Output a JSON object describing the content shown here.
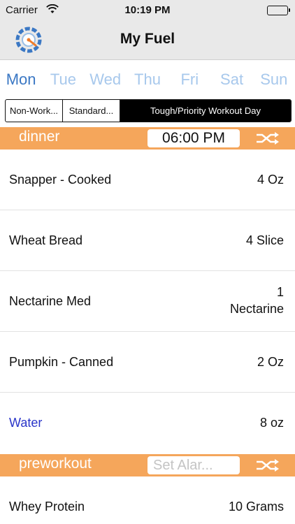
{
  "status_bar": {
    "carrier": "Carrier",
    "time": "10:19 PM"
  },
  "nav": {
    "title": "My Fuel",
    "logo_icon": "gauge-logo-icon"
  },
  "days": [
    {
      "label": "Mon",
      "active": true
    },
    {
      "label": "Tue",
      "active": false
    },
    {
      "label": "Wed",
      "active": false
    },
    {
      "label": "Thu",
      "active": false
    },
    {
      "label": "Fri",
      "active": false
    },
    {
      "label": "Sat",
      "active": false
    },
    {
      "label": "Sun",
      "active": false
    }
  ],
  "day_types": {
    "options": [
      "Non-Work...",
      "Standard...",
      "Tough/Priority Workout Day"
    ],
    "selected": "Tough/Priority Workout Day"
  },
  "meals": [
    {
      "name": "dinner",
      "time": "06:00 PM",
      "items": [
        {
          "food": "Snapper - Cooked",
          "qty": "4 Oz"
        },
        {
          "food": "Wheat Bread",
          "qty": "4 Slice"
        },
        {
          "food": "Nectarine Med",
          "qty_line1": "1",
          "qty_line2": "Nectarine"
        },
        {
          "food": "Pumpkin - Canned",
          "qty": "2 Oz"
        },
        {
          "food": "Water",
          "qty": "8 oz"
        }
      ]
    },
    {
      "name": "preworkout",
      "time_placeholder": "Set Alar...",
      "items": [
        {
          "food": "Whey Protein",
          "qty": "10 Grams"
        }
      ]
    }
  ],
  "colors": {
    "meal_header": "#f5a65b",
    "day_active": "#3b78c4",
    "day_inactive": "#a7c8ec",
    "water_link": "#2a35c9"
  }
}
